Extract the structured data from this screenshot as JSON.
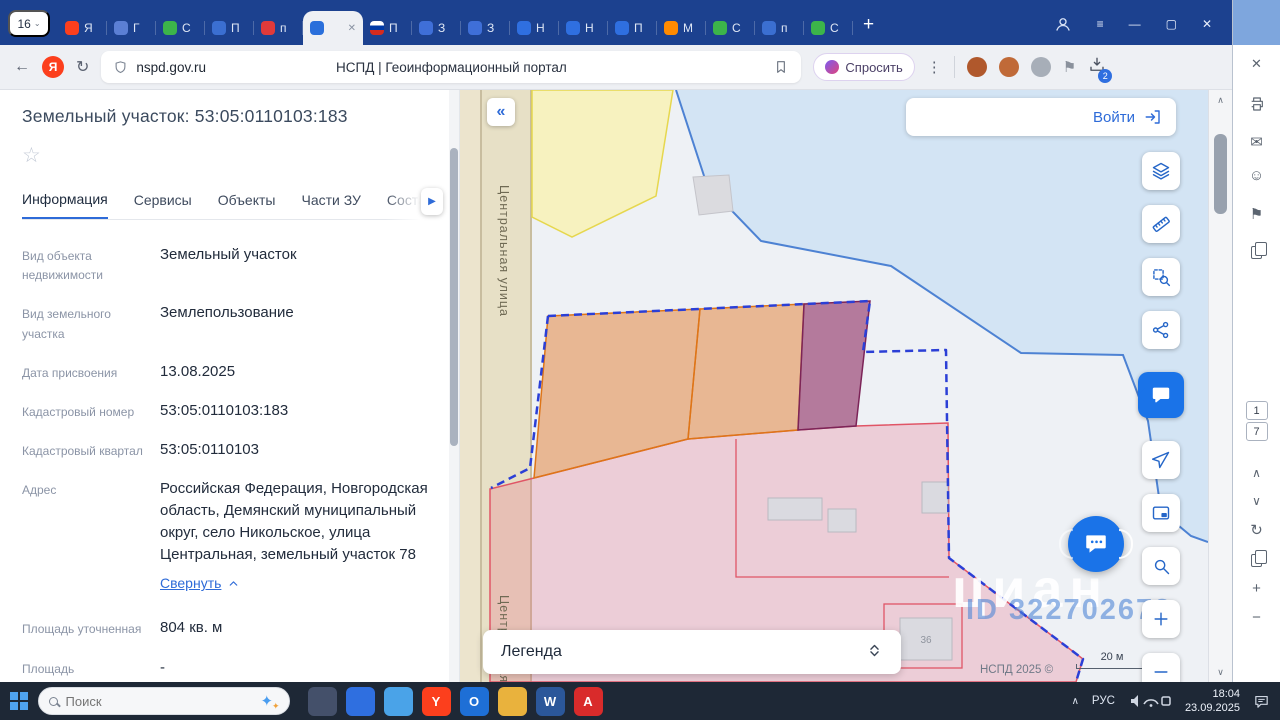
{
  "icons": {
    "close": "✕",
    "star": "☆",
    "back": "←",
    "reload": "↻",
    "menu": "≡",
    "minimize": "—",
    "maximize": "▢",
    "new_tab": "+",
    "collapse_left": "«",
    "tabs_scroll_right": "▶",
    "chevron_up": "∧",
    "chevron_down": "∨",
    "envelope": "✉",
    "smiley": "☺",
    "flag": "⚑",
    "refresh": "↻",
    "plus": "+",
    "minus": "−",
    "dots_vertical": "⋮",
    "yandex_letter": "Я",
    "counter_caret": "⌄"
  },
  "browser": {
    "tab_counter": "16",
    "tabs": [
      {
        "letter": "Я",
        "color": "#fc3f1d"
      },
      {
        "letter": "Г",
        "color": "#5b7fd4"
      },
      {
        "letter": "С",
        "color": "#3cb54a"
      },
      {
        "letter": "П",
        "color": "#3b6fd1"
      },
      {
        "letter": "п",
        "color": "#e03a3a"
      },
      {
        "letter": "",
        "color": "#2a6fdb",
        "active": true
      },
      {
        "letter": "П",
        "color": "linear-gradient(180deg,#ffffff 33%,#0039a6 33% 66%,#d52b1e 66%)"
      },
      {
        "letter": "З",
        "color": "#3f6fd8"
      },
      {
        "letter": "З",
        "color": "#3f6fd8"
      },
      {
        "letter": "Н",
        "color": "#2f6fe0"
      },
      {
        "letter": "Н",
        "color": "#2f6fe0"
      },
      {
        "letter": "П",
        "color": "#2f6fe0"
      },
      {
        "letter": "М",
        "color": "#ff8a00"
      },
      {
        "letter": "С",
        "color": "#3cb54a"
      },
      {
        "letter": "п",
        "color": "#3b6fd1"
      },
      {
        "letter": "С",
        "color": "#3cb54a"
      }
    ],
    "address_bar": {
      "url": "nspd.gov.ru",
      "page_title": "НСПД | Геоинформационный портал",
      "ask_button_label": "Спросить",
      "downloads_badge": "2"
    }
  },
  "panel": {
    "title": "Земельный участок: 53:05:0110103:183",
    "tabs": [
      {
        "label": "Информация",
        "active": true
      },
      {
        "label": "Сервисы"
      },
      {
        "label": "Объекты"
      },
      {
        "label": "Части ЗУ"
      },
      {
        "label": "Соста"
      }
    ],
    "fields_primary": [
      {
        "label": "Вид объекта недвижимости",
        "value": "Земельный участок"
      },
      {
        "label": "Вид земельного участка",
        "value": "Землепользование"
      },
      {
        "label": "Дата присвоения",
        "value": "13.08.2025"
      },
      {
        "label": "Кадастровый номер",
        "value": "53:05:0110103:183"
      },
      {
        "label": "Кадастровый квартал",
        "value": "53:05:0110103"
      },
      {
        "label": "Адрес",
        "value": "Российская Федерация, Новгородская область, Демянский муниципальный округ, село Никольское, улица Центральная, земельный участок 78"
      }
    ],
    "collapse_link_label": "Свернуть",
    "fields_secondary": [
      {
        "label": "Площадь уточненная",
        "value": "804 кв. м"
      },
      {
        "label": "Площадь",
        "value": "-"
      }
    ]
  },
  "map": {
    "login_label": "Войти",
    "street_label": "Центральная улица",
    "legend_label": "Легенда",
    "attribution": "НСПД 2025 ©",
    "scale_label": "20 м",
    "watermark_title": "циан",
    "watermark_id": "ID 322702673",
    "building_label": "36",
    "colors": {
      "selected_outline": "#2b3fd6",
      "parcel_pink_border": "#e05566",
      "parcel_orange_border": "#de7518",
      "accent_blue": "#1a73e8"
    }
  },
  "side_window": {
    "page_current": "1",
    "page_total": "7"
  },
  "taskbar": {
    "search_placeholder": "Поиск",
    "language": "РУС",
    "time": "18:04",
    "date": "23.09.2025",
    "apps": [
      {
        "letter": "",
        "color": "#44506a"
      },
      {
        "letter": "",
        "color": "#2f6fe0"
      },
      {
        "letter": "",
        "color": "#4aa3e8"
      },
      {
        "letter": "Y",
        "color": "#fc3f1d"
      },
      {
        "letter": "O",
        "color": "#1e6fd6"
      },
      {
        "letter": "",
        "color": "#e9b23d"
      },
      {
        "letter": "W",
        "color": "#2b579a"
      },
      {
        "letter": "A",
        "color": "#d92b2b"
      }
    ]
  }
}
